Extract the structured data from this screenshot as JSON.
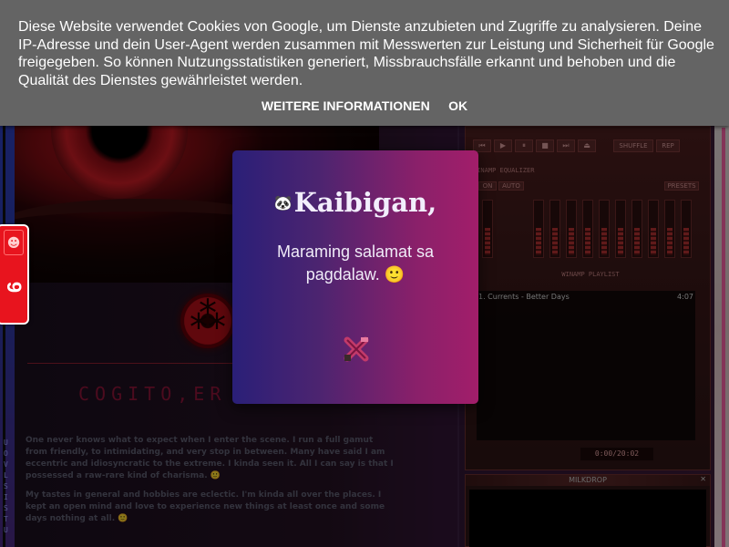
{
  "cookie_banner": {
    "text": "Diese Website verwendet Cookies von Google, um Dienste anzubieten und Zugriffe zu analysieren. Deine IP-Adresse und dein User-Agent werden zusammen mit Messwerten zur Leistung und Sicherheit für Google freigegeben. So können Nutzungsstatistiken generiert, Missbrauchsfälle erkannt und behoben und die Qualität des Dienstes gewährleistet werden.",
    "more_info_label": "WEITERE INFORMATIONEN",
    "ok_label": "OK"
  },
  "modal": {
    "emoji": "🐼",
    "title": "Kaibigan,",
    "message": "Maraming salamat sa pagdalaw.",
    "smiley": "🙂",
    "close_icon": "close-x-icon"
  },
  "side_widget": {
    "number": "9",
    "icon": "badge-icon"
  },
  "page": {
    "tagline": "COGITO,ER",
    "paragraph_1": "One never knows what to expect when I enter the scene. I run a full gamut from friendly, to intimidating, and very stop in between. Many have said I am eccentric and idiosyncratic to the extreme. I kinda seen it. All I can say is that I possessed a raw-rare kind of charisma. 🙂",
    "paragraph_2": "My tastes in general and hobbies are eclectic. I'm kinda all over the places. I kept an open mind and love to experience new things at least once and some days nothing at all. 🙂",
    "vertical_text": "UOVLSISTU"
  },
  "winamp": {
    "shuffle_label": "SHUFFLE",
    "rep_label": "REP",
    "eq_title": "WINAMP EQUALIZER",
    "on_label": "ON",
    "auto_label": "AUTO",
    "presets_label": "PRESETS",
    "playlist_title": "WINAMP PLAYLIST",
    "time": "0:00/20:02",
    "milkdrop_title": "MILKDROP",
    "playlist": [
      {
        "title": "1. Currents - Better Days",
        "time": "4:07"
      }
    ]
  }
}
